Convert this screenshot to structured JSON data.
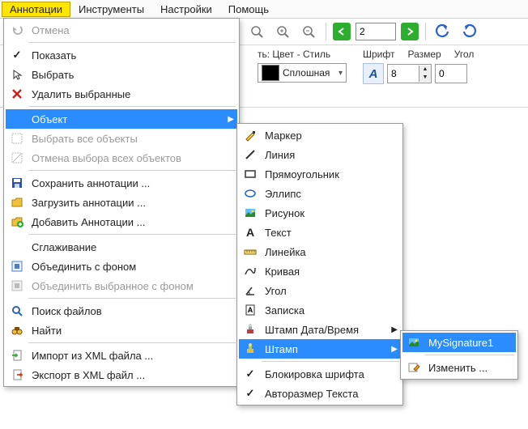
{
  "menubar": {
    "annotations": "Аннотации",
    "tools": "Инструменты",
    "settings": "Настройки",
    "help": "Помощь"
  },
  "toolbar": {
    "page_value": "2"
  },
  "propbar": {
    "colorstyle_label": "ть: Цвет - Стиль",
    "linestyle_value": "Сплошная",
    "font_label": "Шрифт",
    "size_label": "Размер",
    "size_value": "8",
    "angle_label": "Угол",
    "angle_value": "0"
  },
  "menu1": {
    "undo": "Отмена",
    "show": "Показать",
    "select": "Выбрать",
    "delete_selected": "Удалить выбранные",
    "object": "Объект",
    "select_all": "Выбрать все объекты",
    "deselect_all": "Отмена выбора всех объектов",
    "save": "Сохранить аннотации ...",
    "load": "Загрузить аннотации ...",
    "add": "Добавить Аннотации ...",
    "smoothing": "Сглаживание",
    "merge_bg": "Объединить с фоном",
    "merge_sel_bg": "Объединить выбранное с фоном",
    "find_files": "Поиск файлов",
    "find": "Найти",
    "import_xml": "Импорт из XML файла ...",
    "export_xml": "Экспорт в XML файл ..."
  },
  "menu2": {
    "marker": "Маркер",
    "line": "Линия",
    "rect": "Прямоугольник",
    "ellipse": "Эллипс",
    "image": "Рисунок",
    "text": "Текст",
    "ruler": "Линейка",
    "curve": "Кривая",
    "angle": "Угол",
    "note": "Записка",
    "stamp_dt": "Штамп Дата/Время",
    "stamp": "Штамп",
    "lock_font": "Блокировка шрифта",
    "autosize": "Авторазмер Текста"
  },
  "menu3": {
    "sig1": "MySignature1",
    "edit": "Изменить ..."
  }
}
